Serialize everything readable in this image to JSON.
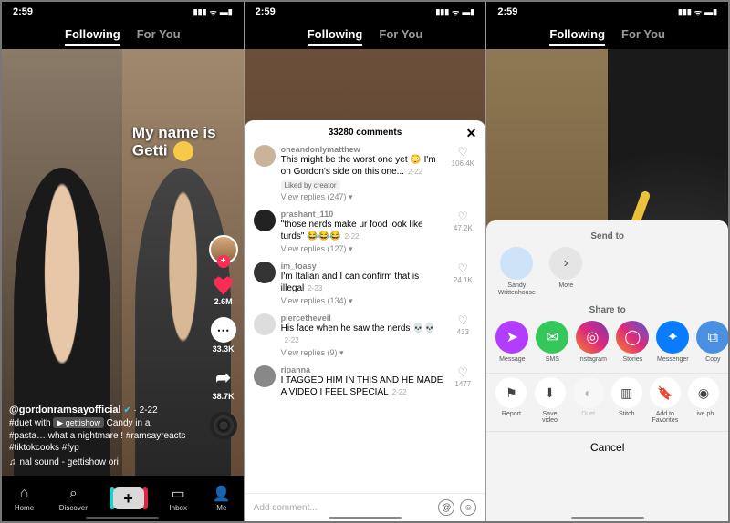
{
  "status": {
    "time": "2:59"
  },
  "tabs": {
    "following": "Following",
    "foryou": "For You",
    "active": "following"
  },
  "video1": {
    "overlay_line1": "My name is",
    "overlay_line2": "Getti",
    "likes": "2.6M",
    "comments": "33.3K",
    "shares": "38.7K",
    "user": "@gordonramsayofficial",
    "post_date": "2-22",
    "caption_pre": "#duet with",
    "caption_chip": "▶ gettishow",
    "caption_rest": "Candy in a #pasta….what a nightmare ! #ramsayreacts #tiktokcooks #fyp",
    "sound": "nal sound - gettishow   ori"
  },
  "nav": {
    "home": "Home",
    "discover": "Discover",
    "inbox": "Inbox",
    "me": "Me"
  },
  "comments_panel": {
    "title": "33280 comments",
    "input_placeholder": "Add comment...",
    "list": [
      {
        "user": "oneandonlymatthew",
        "text": "This might be the worst one yet 😳 I'm on Gordon's side on this one...",
        "date": "2-22",
        "likes": "106.4K",
        "liked_by_creator": "Liked by creator",
        "replies": "View replies (247)",
        "avatar": "#c9b39b"
      },
      {
        "user": "prashant_110",
        "text": "\"those nerds make ur food look like turds\" 😂😂😂",
        "date": "2-22",
        "likes": "47.2K",
        "replies": "View replies (127)",
        "avatar": "#222"
      },
      {
        "user": "im_toasy",
        "text": "I'm Italian and I can confirm that is illegal",
        "date": "2-23",
        "likes": "24.1K",
        "replies": "View replies (134)",
        "avatar": "#333"
      },
      {
        "user": "piercetheveiI",
        "text": "His face when he saw the nerds 💀💀",
        "date": "2-22",
        "likes": "433",
        "replies": "View replies (9)",
        "avatar": "#ddd"
      },
      {
        "user": "ripanna",
        "text": "I TAGGED HIM IN THIS AND HE MADE A VIDEO I FEEL SPECIAL",
        "date": "2-22",
        "likes": "1477",
        "avatar": "#888"
      }
    ]
  },
  "share_panel": {
    "sendto_label": "Send to",
    "shareto_label": "Share to",
    "cancel": "Cancel",
    "send_targets": [
      {
        "name": "Sandy Writtenhouse",
        "color": "#cde3f7"
      },
      {
        "name": "More",
        "color": "#e5e5e5",
        "glyph": "›"
      }
    ],
    "share_targets": [
      {
        "name": "Message",
        "color": "#b23cff",
        "glyph": "➤"
      },
      {
        "name": "SMS",
        "color": "#34c759",
        "glyph": "✉"
      },
      {
        "name": "Instagram",
        "color": "linear-gradient(45deg,#f58529,#dd2a7b,#8134af)",
        "glyph": "◎"
      },
      {
        "name": "Stories",
        "color": "linear-gradient(45deg,#f58529,#dd2a7b,#515bd4)",
        "glyph": "◯"
      },
      {
        "name": "Messenger",
        "color": "#0a7cff",
        "glyph": "✦"
      },
      {
        "name": "Copy",
        "color": "#4a90e2",
        "glyph": "⧉"
      }
    ],
    "actions": [
      {
        "name": "Report",
        "glyph": "⚑"
      },
      {
        "name": "Save video",
        "glyph": "⬇"
      },
      {
        "name": "Duet",
        "glyph": "◐",
        "disabled": true
      },
      {
        "name": "Stitch",
        "glyph": "▥"
      },
      {
        "name": "Add to Favorites",
        "glyph": "🔖"
      },
      {
        "name": "Live ph",
        "glyph": "◉"
      }
    ]
  }
}
